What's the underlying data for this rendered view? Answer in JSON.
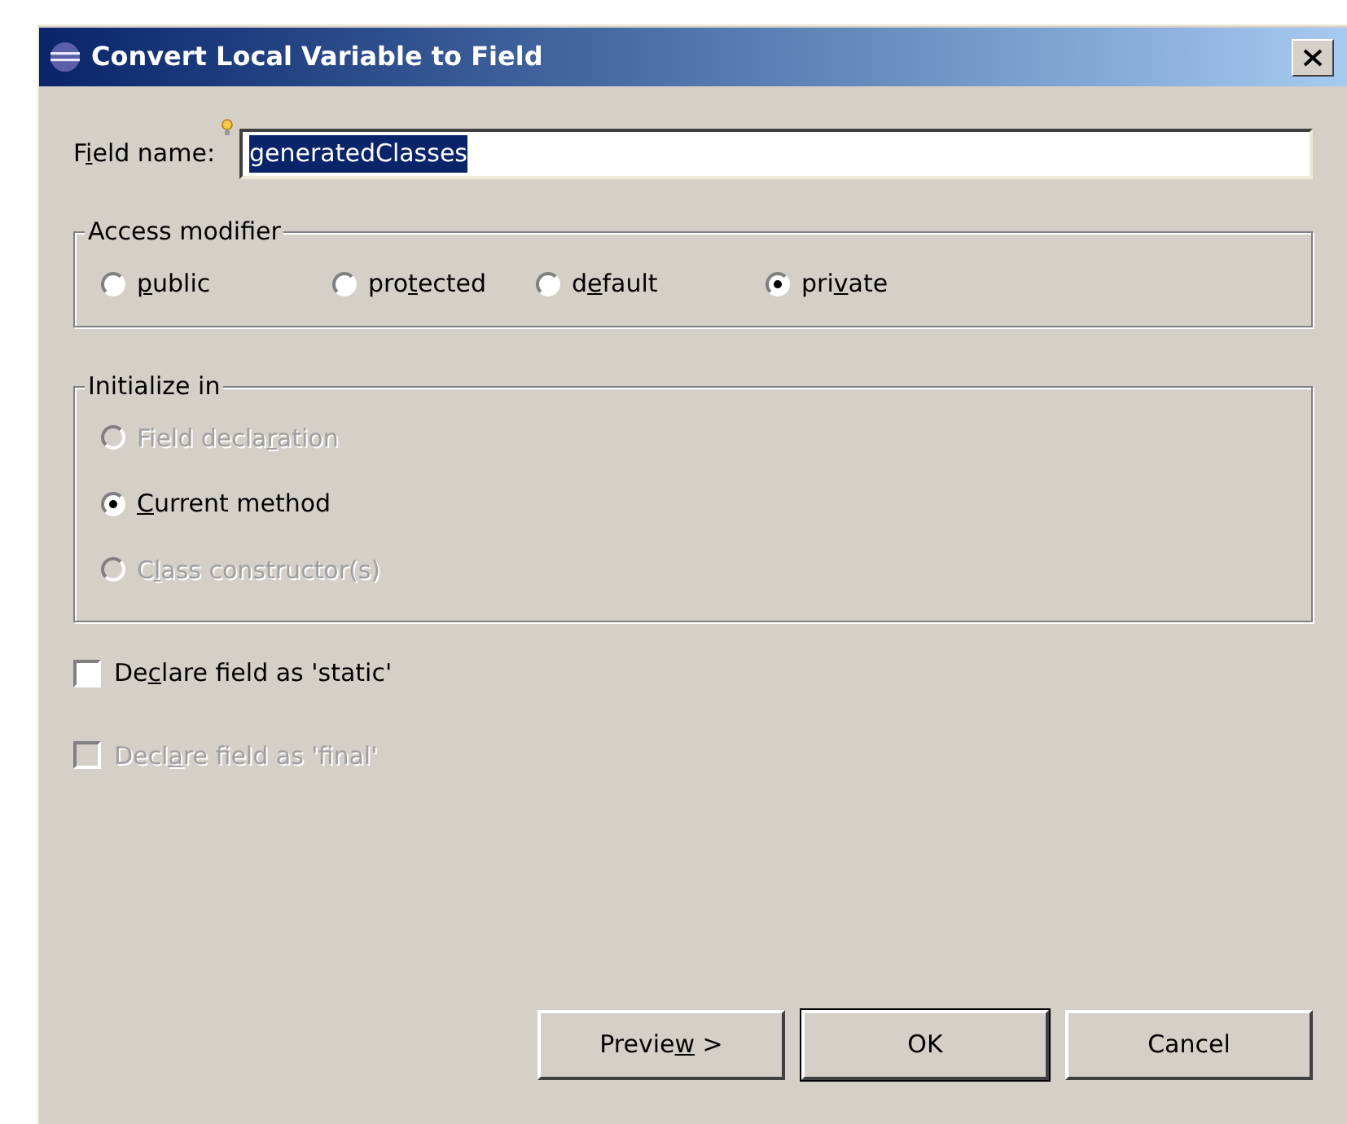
{
  "window": {
    "title": "Convert Local Variable to Field"
  },
  "field_name": {
    "label": {
      "pre": "F",
      "key": "i",
      "post": "eld name:"
    },
    "value": "generatedClasses",
    "selected_text": true
  },
  "access_modifier": {
    "title": "Access modifier",
    "options": [
      {
        "label": {
          "key": "p",
          "post": "ublic"
        },
        "selected": false,
        "disabled": false
      },
      {
        "label": {
          "pre": "pro",
          "key": "t",
          "post": "ected"
        },
        "selected": false,
        "disabled": false
      },
      {
        "label": {
          "pre": "d",
          "key": "e",
          "post": "fault"
        },
        "selected": false,
        "disabled": false
      },
      {
        "label": {
          "pre": "pri",
          "key": "v",
          "post": "ate"
        },
        "selected": true,
        "disabled": false
      }
    ]
  },
  "initialize_in": {
    "title": "Initialize in",
    "options": [
      {
        "label": {
          "pre": "Field decla",
          "key": "r",
          "post": "ation"
        },
        "selected": false,
        "disabled": true
      },
      {
        "label": {
          "key": "C",
          "post": "urrent method"
        },
        "selected": true,
        "disabled": false
      },
      {
        "label": {
          "pre": "C",
          "key": "l",
          "post": "ass constructor(s)"
        },
        "selected": false,
        "disabled": true
      }
    ]
  },
  "checkboxes": [
    {
      "label": {
        "pre": "De",
        "key": "c",
        "post": "lare field as 'static'"
      },
      "checked": false,
      "disabled": false
    },
    {
      "label": {
        "pre": "Decl",
        "key": "a",
        "post": "re field as 'final'"
      },
      "checked": false,
      "disabled": true
    }
  ],
  "buttons": [
    {
      "label": {
        "pre": "Previe",
        "key": "w",
        "post": " >"
      },
      "default": false
    },
    {
      "label": {
        "pre": "OK"
      },
      "default": true
    },
    {
      "label": {
        "pre": "Cancel"
      },
      "default": false
    }
  ]
}
